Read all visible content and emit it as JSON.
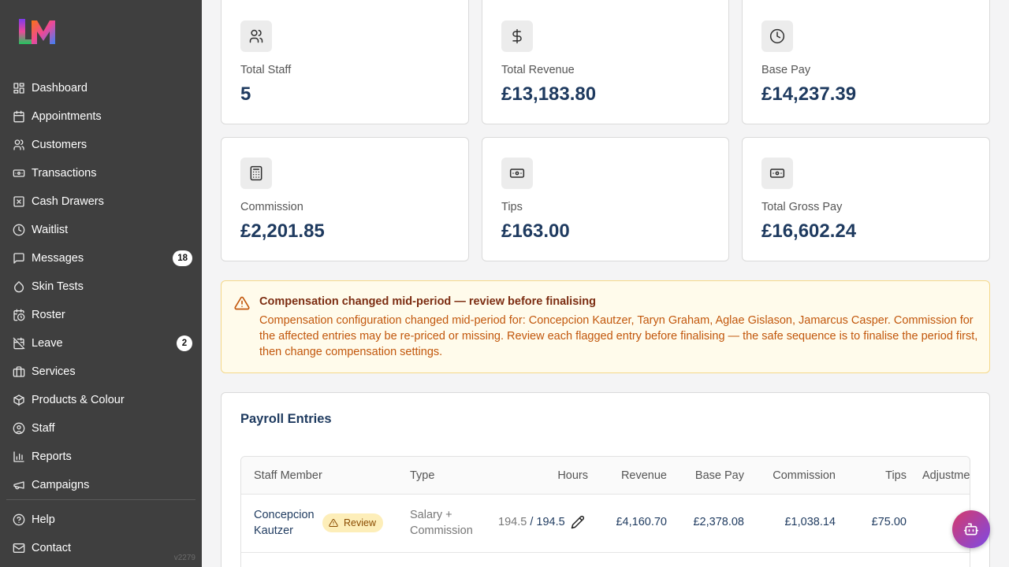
{
  "sidebar": {
    "logo_text": "LM",
    "items": [
      {
        "label": "Dashboard",
        "icon": "dashboard-icon"
      },
      {
        "label": "Appointments",
        "icon": "calendar-icon"
      },
      {
        "label": "Customers",
        "icon": "users-icon"
      },
      {
        "label": "Transactions",
        "icon": "banknote-icon"
      },
      {
        "label": "Cash Drawers",
        "icon": "x-square-icon"
      },
      {
        "label": "Waitlist",
        "icon": "clock-icon"
      },
      {
        "label": "Messages",
        "icon": "message-icon",
        "badge": "18"
      },
      {
        "label": "Skin Tests",
        "icon": "droplet-icon"
      },
      {
        "label": "Roster",
        "icon": "calendar-clock-icon"
      },
      {
        "label": "Leave",
        "icon": "calendar-off-icon",
        "badge": "2"
      },
      {
        "label": "Services",
        "icon": "briefcase-icon"
      },
      {
        "label": "Products & Colour",
        "icon": "package-icon"
      },
      {
        "label": "Staff",
        "icon": "user-circle-icon"
      },
      {
        "label": "Reports",
        "icon": "bar-chart-icon"
      },
      {
        "label": "Campaigns",
        "icon": "megaphone-icon"
      }
    ],
    "bottom_items": [
      {
        "label": "Help",
        "icon": "help-icon"
      },
      {
        "label": "Contact",
        "icon": "mail-icon"
      }
    ],
    "version": "v2279"
  },
  "stats": [
    {
      "label": "Total Staff",
      "value": "5",
      "icon": "users-icon"
    },
    {
      "label": "Total Revenue",
      "value": "£13,183.80",
      "icon": "dollar-icon"
    },
    {
      "label": "Base Pay",
      "value": "£14,237.39",
      "icon": "clock-icon"
    },
    {
      "label": "Commission",
      "value": "£2,201.85",
      "icon": "calculator-icon"
    },
    {
      "label": "Tips",
      "value": "£163.00",
      "icon": "banknote-icon"
    },
    {
      "label": "Total Gross Pay",
      "value": "£16,602.24",
      "icon": "banknote-icon"
    }
  ],
  "alert": {
    "title": "Compensation changed mid-period — review before finalising",
    "body": "Compensation configuration changed mid-period for: Concepcion Kautzer, Taryn Graham, Aglae Gislason, Jamarcus Casper. Commission for the affected entries may be re-priced or missing. Review each flagged entry before finalising — the safe sequence is to finalise the period first, then change compensation settings."
  },
  "payroll": {
    "title": "Payroll Entries",
    "columns": [
      "Staff Member",
      "Type",
      "Hours",
      "Revenue",
      "Base Pay",
      "Commission",
      "Tips",
      "Adjustments"
    ],
    "rows": [
      {
        "name": "Concepcion Kautzer",
        "badge": "Review",
        "type": "Salary + Commission",
        "hours_actual": "194.5",
        "hours_sep": " / ",
        "hours_paid": "194.5",
        "revenue": "£4,160.70",
        "base_pay": "£2,378.08",
        "commission": "£1,038.14",
        "tips": "£75.00"
      }
    ]
  },
  "colors": {
    "sidebar_bg": "#3f3f3f",
    "accent_navy": "#1e3a5f",
    "alert_bg": "#fffbeb",
    "alert_text": "#c2570c"
  }
}
